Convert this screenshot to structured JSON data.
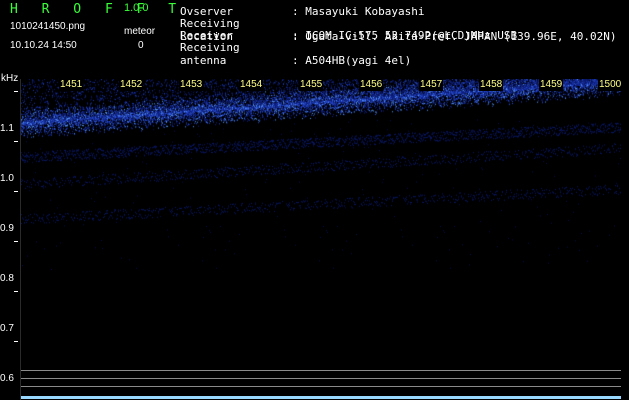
{
  "header": {
    "app_name": "H R O F F T",
    "version": "1.0.0",
    "filename": "1010241450.png",
    "timestamp": "10.10.24 14:50",
    "meteor_label": "meteor",
    "meteor_count": "0"
  },
  "info": [
    {
      "key": "Ovserver",
      "value": ": Masayuki Kobayashi"
    },
    {
      "key": "Receiving Location",
      "value": ": Ogata-vill. Akita-Pref. JAPAN (139.96E, 40.02N)"
    },
    {
      "key": "Receiver",
      "value": ": ICOM IC-575 53.7492(@LCD)MHz USB"
    },
    {
      "key": "Receiving antenna",
      "value": ": A504HB(yagi 4el)"
    }
  ],
  "plot": {
    "y_unit": "kHz",
    "x_ticks": [
      "1451",
      "1452",
      "1453",
      "1454",
      "1455",
      "1456",
      "1457",
      "1458",
      "1459",
      "1500"
    ],
    "y_ticks": [
      "1.1",
      "1.0",
      "0.9",
      "0.8",
      "0.7",
      "0.6"
    ],
    "colors": {
      "signal_dark": "#0a1a8c",
      "signal_bright": "#3a7cff",
      "tick": "#ffff88"
    }
  }
}
